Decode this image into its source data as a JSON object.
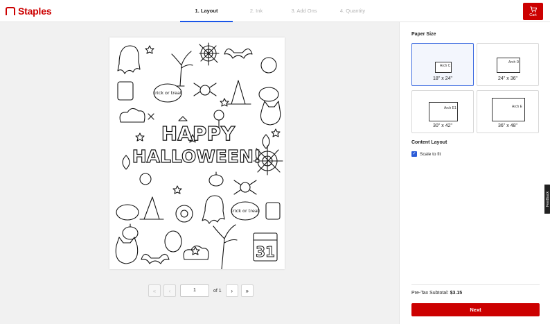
{
  "header": {
    "brand": "Staples",
    "steps": [
      {
        "label": "1. Layout",
        "active": true
      },
      {
        "label": "2. Ink",
        "active": false
      },
      {
        "label": "3. Add Ons",
        "active": false
      },
      {
        "label": "4. Quantity",
        "active": false
      }
    ],
    "cart_label": "Cart"
  },
  "preview": {
    "poster_title_line1": "HAPPY",
    "poster_title_line2": "HALLOWEEN!",
    "speech_text_1": "trick or treat",
    "speech_text_2": "trick or treat",
    "calendar_number": "31",
    "pager": {
      "current_page": "1",
      "of_label": "of 1",
      "first_icon": "double-chevron-left-icon",
      "prev_icon": "chevron-left-icon",
      "next_icon": "chevron-right-icon",
      "last_icon": "double-chevron-right-icon"
    }
  },
  "panel": {
    "paper_size_title": "Paper Size",
    "sizes": [
      {
        "label": "Arch C",
        "caption": "18\" x 24\"",
        "selected": true
      },
      {
        "label": "Arch D",
        "caption": "24\" x 36\"",
        "selected": false
      },
      {
        "label": "Arch E1",
        "caption": "30\" x 42\"",
        "selected": false
      },
      {
        "label": "Arch E",
        "caption": "36\" x 48\"",
        "selected": false
      }
    ],
    "content_layout_title": "Content Layout",
    "scale_to_fit_label": "Scale to fit",
    "scale_to_fit_checked": true,
    "subtotal_label": "Pre-Tax Subtotal:",
    "subtotal_value": "$3.15",
    "next_label": "Next"
  },
  "feedback_label": "Feedback",
  "colors": {
    "brand_red": "#cc0000",
    "accent_blue": "#1a56e8",
    "selected_card_bg": "#f3f6fd"
  }
}
